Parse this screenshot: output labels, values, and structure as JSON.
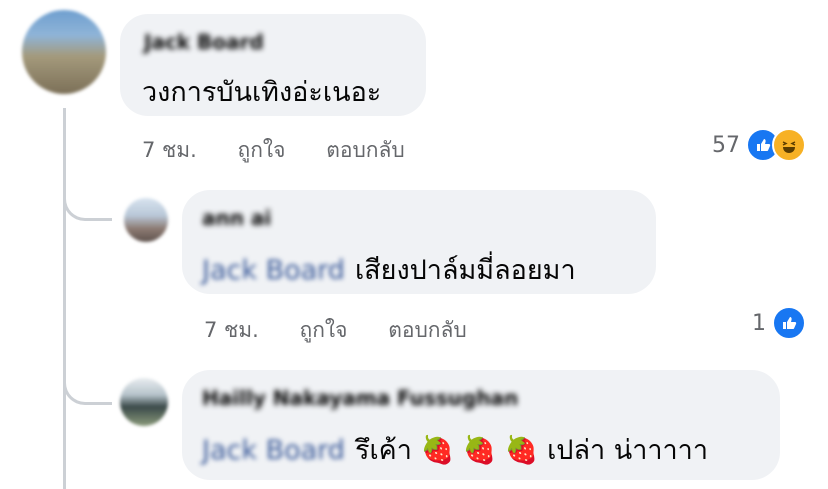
{
  "comments": [
    {
      "author": "Jack Board",
      "text": "วงการบันเทิงอ่ะเนอะ",
      "time": "7 ชม.",
      "like_label": "ถูกใจ",
      "reply_label": "ตอบกลับ",
      "reaction_count": "57",
      "reactions": [
        "like-icon",
        "haha-icon"
      ]
    },
    {
      "author": "ann ai",
      "mention": "Jack Board",
      "text": "เสียงปาล์มมี่ลอยมา",
      "time": "7 ชม.",
      "like_label": "ถูกใจ",
      "reply_label": "ตอบกลับ",
      "reaction_count": "1",
      "reactions": [
        "like-icon"
      ]
    },
    {
      "author": "Hailly Nakayama Fussughan",
      "mention": "Jack Board",
      "text": "รึเค้า 🍓 🍓 🍓 เปล่า น่าาาาา"
    }
  ],
  "colors": {
    "bubble": "#f0f2f5",
    "meta": "#65676b",
    "like": "#1877f2",
    "haha": "#f7b125",
    "mention": "#385898"
  }
}
